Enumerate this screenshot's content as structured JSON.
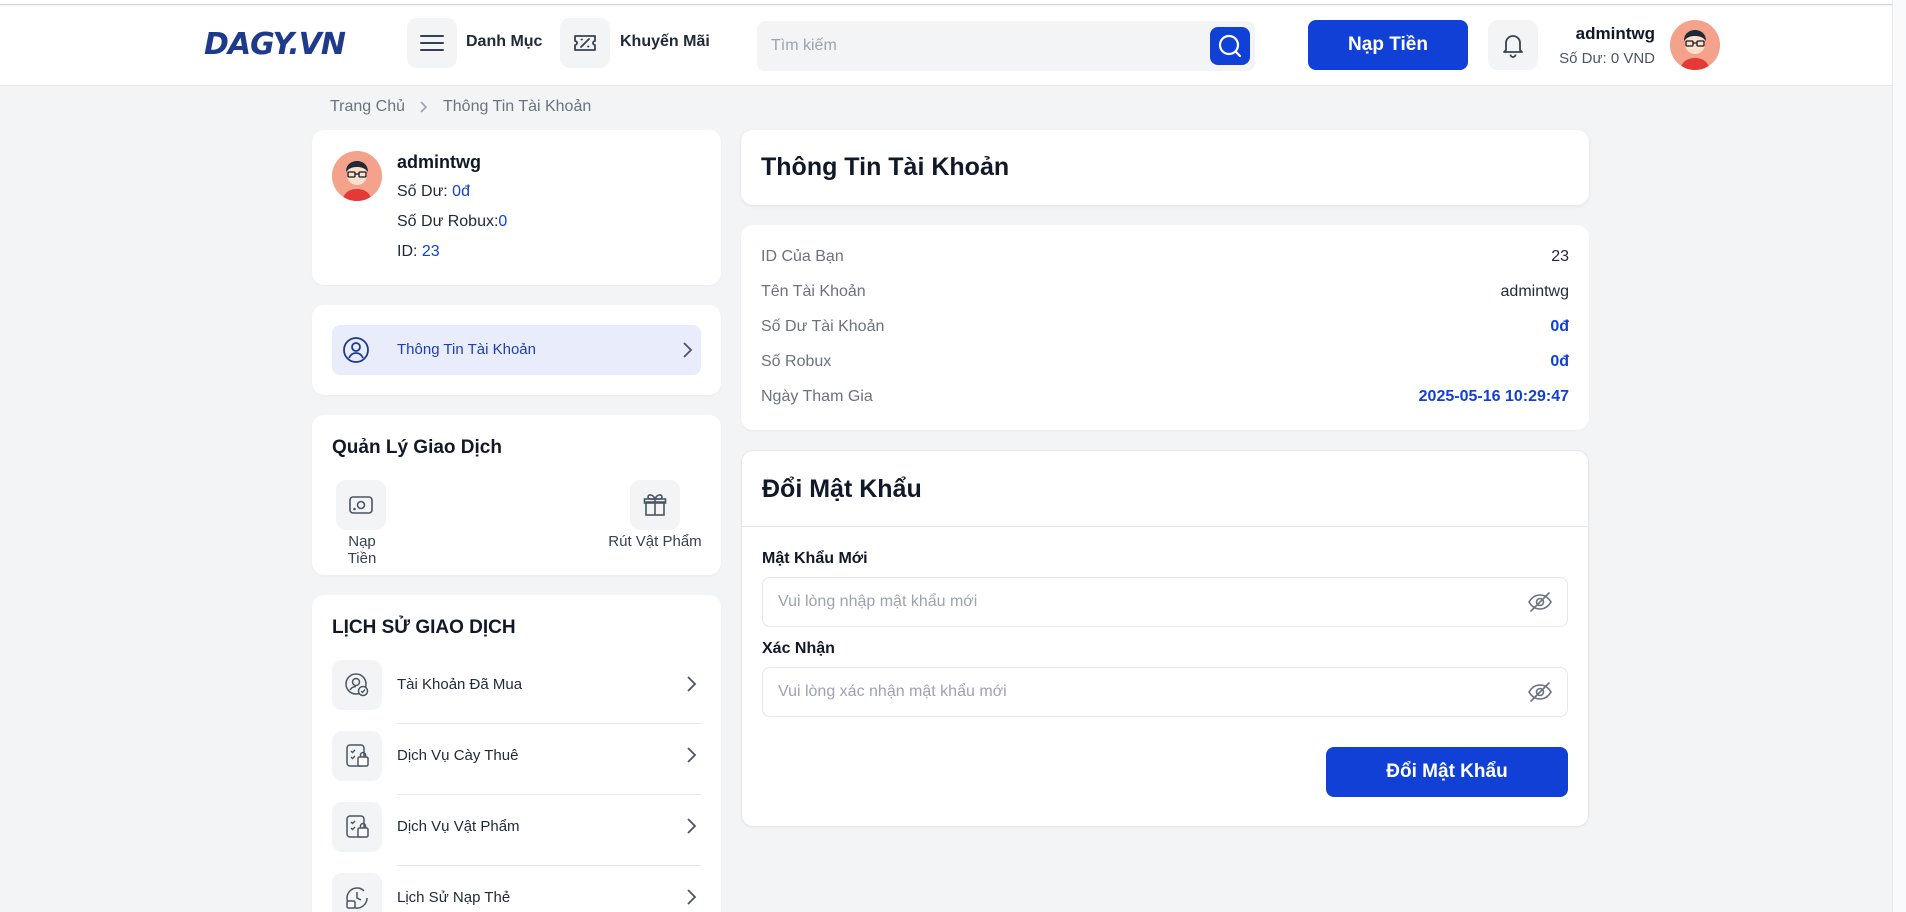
{
  "header": {
    "logo_text": "DAGY.VN",
    "menu_label": "Danh Mục",
    "promo_label": "Khuyến Mãi",
    "search_placeholder": "Tìm kiếm",
    "topup_label": "Nạp Tiền",
    "username": "admintwg",
    "balance_text": "Số Dư: 0 VND"
  },
  "breadcrumb": {
    "home": "Trang Chủ",
    "current": "Thông Tin Tài Khoản"
  },
  "profile": {
    "name": "admintwg",
    "balance_label": "Số Dư: ",
    "balance_value": "0đ",
    "robux_label": "Số Dư Robux:",
    "robux_value": "0",
    "id_label": "ID: ",
    "id_value": "23"
  },
  "menu": {
    "account_info": "Thông Tin Tài Khoản"
  },
  "transactions": {
    "title": "Quản Lý Giao Dịch",
    "topup": "Nạp Tiền",
    "withdraw": "Rút Vật Phẩm"
  },
  "history": {
    "title": "LỊCH SỬ GIAO DỊCH",
    "items": [
      {
        "label": "Tài Khoản Đã Mua",
        "icon": "user-check-icon"
      },
      {
        "label": "Dịch Vụ Cày Thuê",
        "icon": "service-list-icon"
      },
      {
        "label": "Dịch Vụ Vật Phẩm",
        "icon": "item-list-icon"
      },
      {
        "label": "Lịch Sử Nạp Thẻ",
        "icon": "clock-card-icon"
      }
    ]
  },
  "account_info": {
    "title": "Thông Tin Tài Khoản",
    "rows": [
      {
        "label": "ID Của Bạn",
        "value": "23"
      },
      {
        "label": "Tên Tài Khoản",
        "value": "admintwg"
      },
      {
        "label": "Số Dư Tài Khoản",
        "value": "0đ"
      },
      {
        "label": "Số Robux",
        "value": "0đ"
      },
      {
        "label": "Ngày Tham Gia",
        "value": "2025-05-16 10:29:47"
      }
    ]
  },
  "change_password": {
    "title": "Đổi Mật Khẩu",
    "new_label": "Mật Khẩu Mới",
    "new_placeholder": "Vui lòng nhập mật khẩu mới",
    "confirm_label": "Xác Nhận",
    "confirm_placeholder": "Vui lòng xác nhận mật khẩu mới",
    "submit_label": "Đổi Mật Khẩu"
  },
  "colors": {
    "primary": "#1040d6",
    "background": "#f3f4f6",
    "active_menu": "#e8ecfb"
  }
}
